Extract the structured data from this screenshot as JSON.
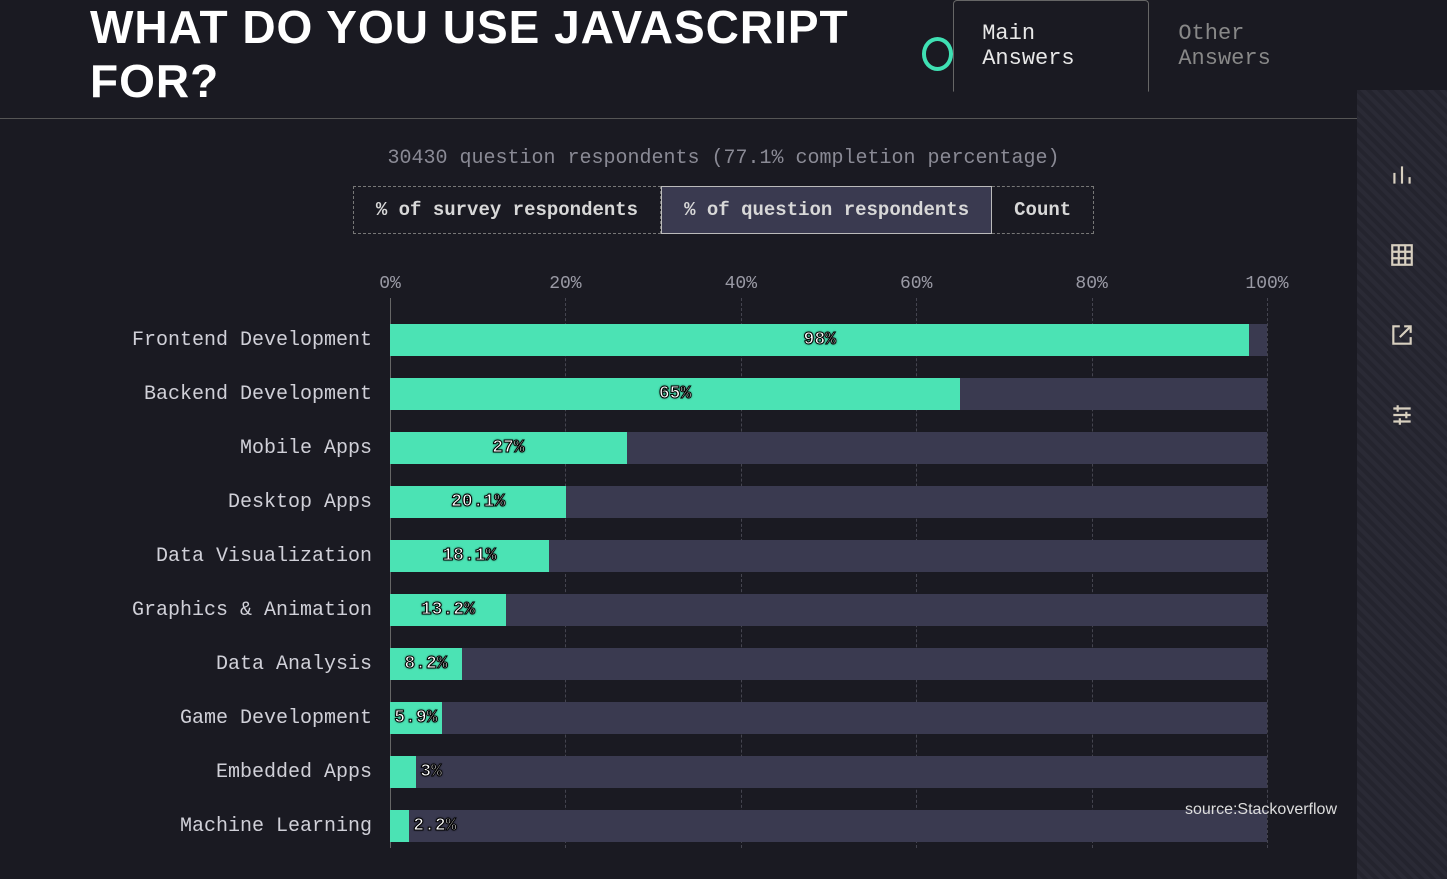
{
  "title": "WHAT DO YOU USE JAVASCRIPT FOR?",
  "tabs": {
    "main": "Main Answers",
    "other": "Other Answers"
  },
  "meta": "30430 question respondents (77.1% completion percentage)",
  "toggles": {
    "survey": "% of survey respondents",
    "question": "% of question respondents",
    "count": "Count"
  },
  "axis_ticks": [
    "0%",
    "20%",
    "40%",
    "60%",
    "80%",
    "100%"
  ],
  "source": "source:Stackoverflow",
  "chart_data": {
    "type": "bar",
    "orientation": "horizontal",
    "title": "What do you use JavaScript for?",
    "xlabel": "% of question respondents",
    "ylabel": "",
    "xlim": [
      0,
      100
    ],
    "categories": [
      "Frontend Development",
      "Backend Development",
      "Mobile Apps",
      "Desktop Apps",
      "Data Visualization",
      "Graphics & Animation",
      "Data Analysis",
      "Game Development",
      "Embedded Apps",
      "Machine Learning"
    ],
    "values": [
      98,
      65,
      27,
      20.1,
      18.1,
      13.2,
      8.2,
      5.9,
      3,
      2.2
    ],
    "value_labels": [
      "98%",
      "65%",
      "27%",
      "20.1%",
      "18.1%",
      "13.2%",
      "8.2%",
      "5.9%",
      "3%",
      "2.2%"
    ]
  }
}
